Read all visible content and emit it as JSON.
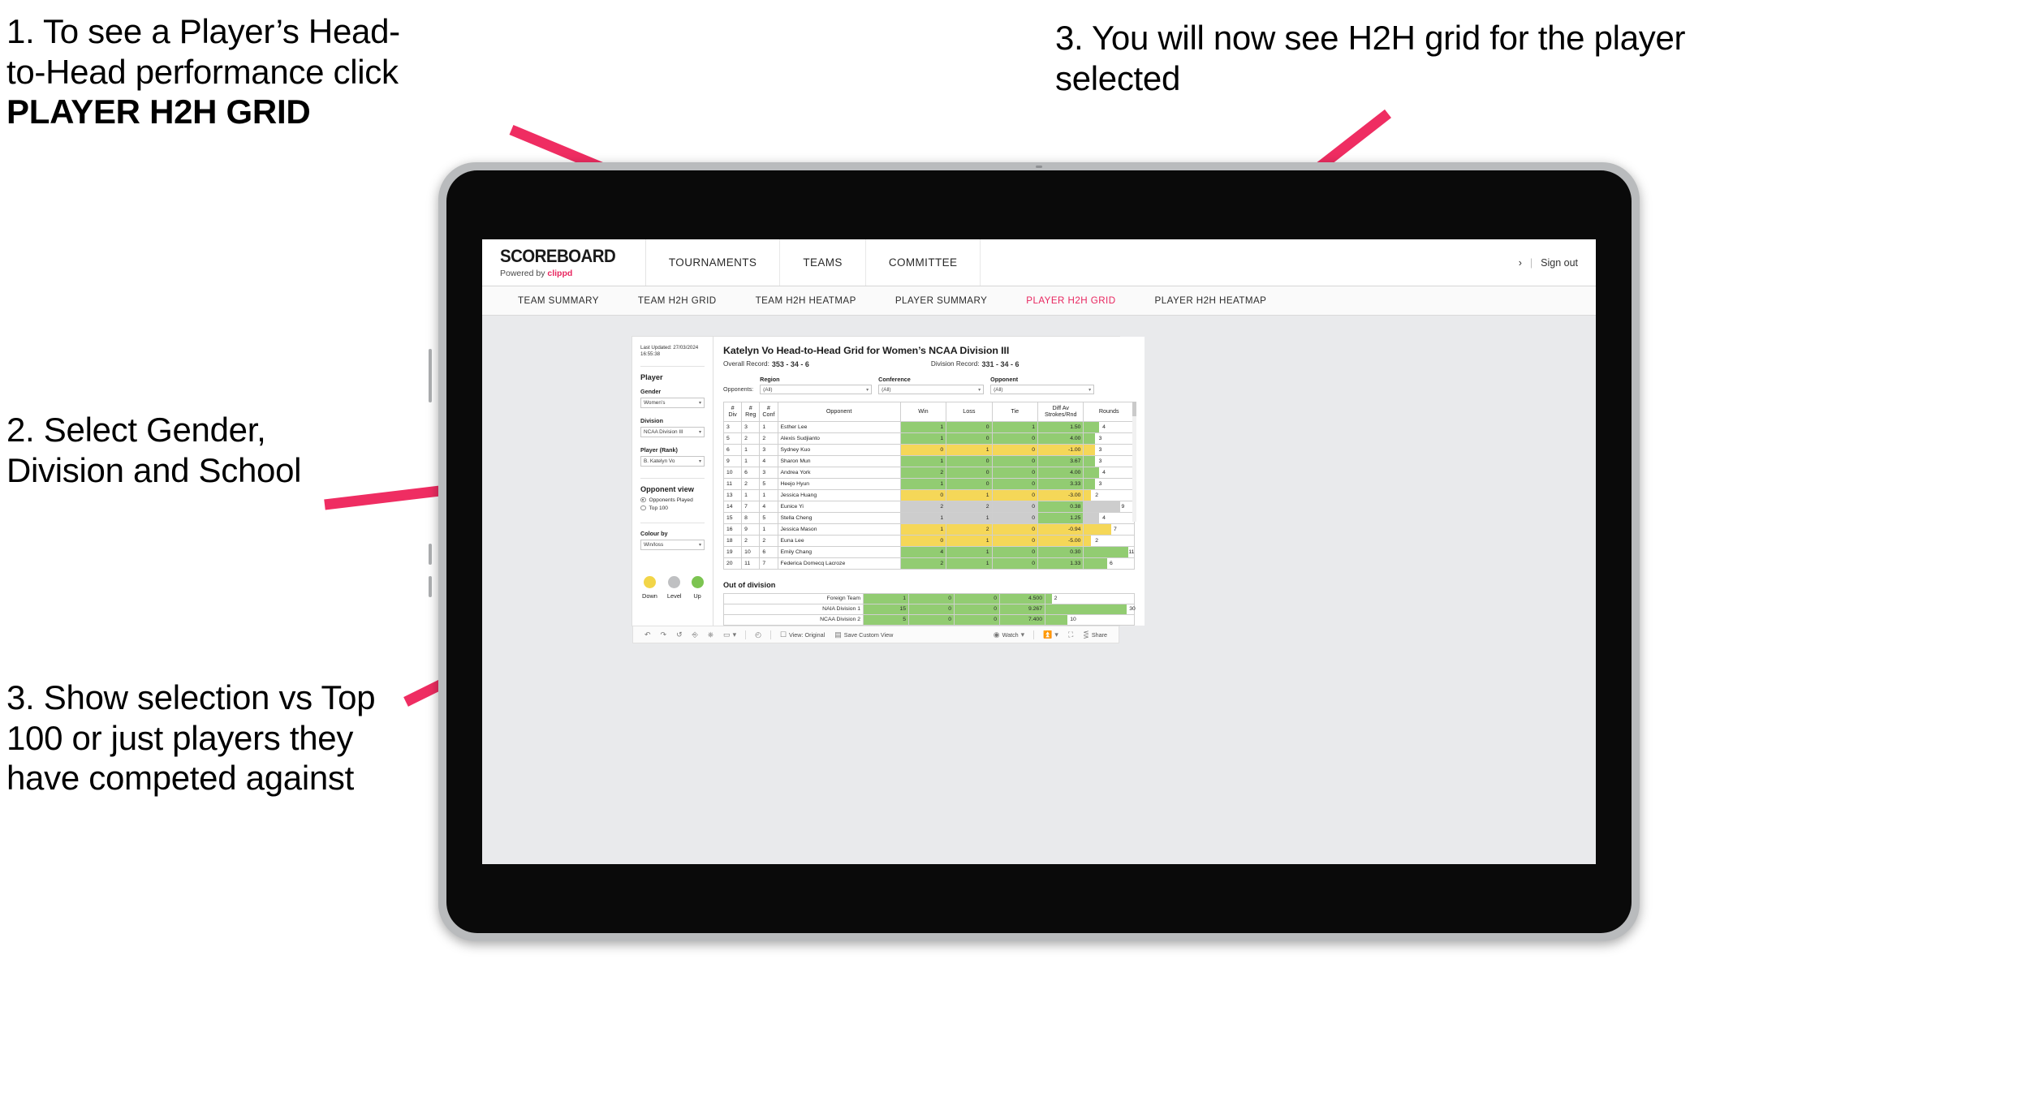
{
  "annotations": [
    {
      "id": "anno1",
      "lines": [
        "1. To see a Player’s Head-",
        "to-Head performance click"
      ],
      "bold_line": "PLAYER H2H GRID"
    },
    {
      "id": "anno2",
      "text": "2. Select Gender, Division and School"
    },
    {
      "id": "anno3",
      "text": "3. Show selection vs Top 100 or just players they have competed against"
    },
    {
      "id": "anno4",
      "text": "3. You will now see H2H grid for the player selected"
    }
  ],
  "app": {
    "brand": {
      "name": "SCOREBOARD",
      "powered_prefix": "Powered by ",
      "powered_brand": "clippd"
    },
    "top_nav": [
      "TOURNAMENTS",
      "TEAMS",
      "COMMITTEE"
    ],
    "account": {
      "divider": "|",
      "sign_out": "Sign out"
    },
    "sub_nav": [
      {
        "label": "TEAM SUMMARY",
        "active": false
      },
      {
        "label": "TEAM H2H GRID",
        "active": false
      },
      {
        "label": "TEAM H2H HEATMAP",
        "active": false
      },
      {
        "label": "PLAYER SUMMARY",
        "active": false
      },
      {
        "label": "PLAYER H2H GRID",
        "active": true
      },
      {
        "label": "PLAYER H2H HEATMAP",
        "active": false
      }
    ]
  },
  "sidebar": {
    "last_updated": "Last Updated: 27/03/2024 16:55:38",
    "player_heading": "Player",
    "gender": {
      "label": "Gender",
      "value": "Women’s"
    },
    "division": {
      "label": "Division",
      "value": "NCAA Division III"
    },
    "player_rank": {
      "label": "Player (Rank)",
      "value": "B. Katelyn Vo"
    },
    "opponent_view": {
      "heading": "Opponent view",
      "options": [
        {
          "label": "Opponents Played",
          "selected": true
        },
        {
          "label": "Top 100",
          "selected": false
        }
      ]
    },
    "colour_by": {
      "label": "Colour by",
      "value": "Win/loss"
    },
    "legend": [
      {
        "label": "Down",
        "color": "#f2d548"
      },
      {
        "label": "Level",
        "color": "#bfc0c2"
      },
      {
        "label": "Up",
        "color": "#7cc451"
      }
    ]
  },
  "report": {
    "title": "Katelyn Vo Head-to-Head Grid for Women’s NCAA Division III",
    "overall_record_label": "Overall Record:",
    "overall_record_value": "353 -  34 - 6",
    "division_record_label": "Division Record:",
    "division_record_value": "331 -  34 - 6",
    "opponents_label": "Opponents:",
    "filters": [
      {
        "caption": "Region",
        "value": "(All)"
      },
      {
        "caption": "Conference",
        "value": "(All)"
      },
      {
        "caption": "Opponent",
        "value": "(All)"
      }
    ],
    "columns": [
      "#\nDiv",
      "#\nReg",
      "#\nConf",
      "Opponent",
      "Win",
      "Loss",
      "Tie",
      "Diff Av Strokes/Rnd",
      "Rounds"
    ],
    "column_labels": {
      "div": [
        "#",
        "Div"
      ],
      "reg": [
        "#",
        "Reg"
      ],
      "conf": [
        "#",
        "Conf"
      ],
      "opponent": "Opponent",
      "win": "Win",
      "loss": "Loss",
      "tie": "Tie",
      "diff": [
        "Diff Av",
        "Strokes/Rnd"
      ],
      "rounds": "Rounds"
    },
    "rows": [
      {
        "div": "3",
        "reg": "3",
        "conf": "1",
        "opponent": "Esther Lee",
        "win": "1",
        "loss": "0",
        "tie": "1",
        "diff": "1.50",
        "rounds": "4",
        "color": "#92cc72",
        "bar_pct": 30
      },
      {
        "div": "5",
        "reg": "2",
        "conf": "2",
        "opponent": "Alexis Sudjianto",
        "win": "1",
        "loss": "0",
        "tie": "0",
        "diff": "4.00",
        "rounds": "3",
        "color": "#92cc72",
        "bar_pct": 22
      },
      {
        "div": "6",
        "reg": "1",
        "conf": "3",
        "opponent": "Sydney Kuo",
        "win": "0",
        "loss": "1",
        "tie": "0",
        "diff": "-1.00",
        "rounds": "3",
        "color": "#f5d758",
        "bar_pct": 22
      },
      {
        "div": "9",
        "reg": "1",
        "conf": "4",
        "opponent": "Sharon Mun",
        "win": "1",
        "loss": "0",
        "tie": "0",
        "diff": "3.67",
        "rounds": "3",
        "color": "#92cc72",
        "bar_pct": 22
      },
      {
        "div": "10",
        "reg": "6",
        "conf": "3",
        "opponent": "Andrea York",
        "win": "2",
        "loss": "0",
        "tie": "0",
        "diff": "4.00",
        "rounds": "4",
        "color": "#92cc72",
        "bar_pct": 30
      },
      {
        "div": "11",
        "reg": "2",
        "conf": "5",
        "opponent": "Heejo Hyun",
        "win": "1",
        "loss": "0",
        "tie": "0",
        "diff": "3.33",
        "rounds": "3",
        "color": "#92cc72",
        "bar_pct": 22
      },
      {
        "div": "13",
        "reg": "1",
        "conf": "1",
        "opponent": "Jessica Huang",
        "win": "0",
        "loss": "1",
        "tie": "0",
        "diff": "-3.00",
        "rounds": "2",
        "color": "#f5d758",
        "bar_pct": 14
      },
      {
        "div": "14",
        "reg": "7",
        "conf": "4",
        "opponent": "Eunice Yi",
        "win": "2",
        "loss": "2",
        "tie": "0",
        "diff": "0.38",
        "rounds": "9",
        "color": "#cdcdcd",
        "diff_color": "#92cc72",
        "bar_pct": 72
      },
      {
        "div": "15",
        "reg": "8",
        "conf": "5",
        "opponent": "Stella Cheng",
        "win": "1",
        "loss": "1",
        "tie": "0",
        "diff": "1.25",
        "rounds": "4",
        "color": "#cdcdcd",
        "diff_color": "#92cc72",
        "bar_pct": 30
      },
      {
        "div": "16",
        "reg": "9",
        "conf": "1",
        "opponent": "Jessica Mason",
        "win": "1",
        "loss": "2",
        "tie": "0",
        "diff": "-0.94",
        "rounds": "7",
        "color": "#f5d758",
        "bar_pct": 55
      },
      {
        "div": "18",
        "reg": "2",
        "conf": "2",
        "opponent": "Euna Lee",
        "win": "0",
        "loss": "1",
        "tie": "0",
        "diff": "-5.00",
        "rounds": "2",
        "color": "#f5d758",
        "bar_pct": 14
      },
      {
        "div": "19",
        "reg": "10",
        "conf": "6",
        "opponent": "Emily Chang",
        "win": "4",
        "loss": "1",
        "tie": "0",
        "diff": "0.30",
        "rounds": "11",
        "color": "#92cc72",
        "bar_pct": 88
      },
      {
        "div": "20",
        "reg": "11",
        "conf": "7",
        "opponent": "Federica Domecq Lacroze",
        "win": "2",
        "loss": "1",
        "tie": "0",
        "diff": "1.33",
        "rounds": "6",
        "color": "#92cc72",
        "bar_pct": 46
      }
    ],
    "out_of_division": {
      "title": "Out of division",
      "rows": [
        {
          "name": "Foreign Team",
          "win": "1",
          "loss": "0",
          "tie": "0",
          "diff": "4.500",
          "rounds": "2",
          "color": "#92cc72",
          "bar_pct": 7
        },
        {
          "name": "NAIA Division 1",
          "win": "15",
          "loss": "0",
          "tie": "0",
          "diff": "9.267",
          "rounds": "30",
          "color": "#92cc72",
          "bar_pct": 92
        },
        {
          "name": "NCAA Division 2",
          "win": "5",
          "loss": "0",
          "tie": "0",
          "diff": "7.400",
          "rounds": "10",
          "color": "#92cc72",
          "bar_pct": 25
        }
      ]
    }
  },
  "toolbar": {
    "items": [
      {
        "name": "undo",
        "glyph": "↶",
        "label": ""
      },
      {
        "name": "redo",
        "glyph": "↷",
        "label": ""
      },
      {
        "name": "revert",
        "glyph": "↺",
        "label": ""
      },
      {
        "name": "refresh",
        "glyph": "☷",
        "label": ""
      },
      {
        "name": "pause",
        "glyph": "⏸",
        "label": ""
      },
      {
        "name": "shape",
        "glyph": "▭",
        "label": ""
      }
    ],
    "zoom_glyph": "◴",
    "view_original": "View: Original",
    "save_custom_view": "Save Custom View",
    "watch": "Watch",
    "share": "Share",
    "caret": "▾"
  },
  "colors": {
    "accent_pink": "#e8265f",
    "green": "#92cc72",
    "yellow": "#f5d758",
    "grey": "#cdcdcd",
    "arrow": "#ef2d62"
  }
}
